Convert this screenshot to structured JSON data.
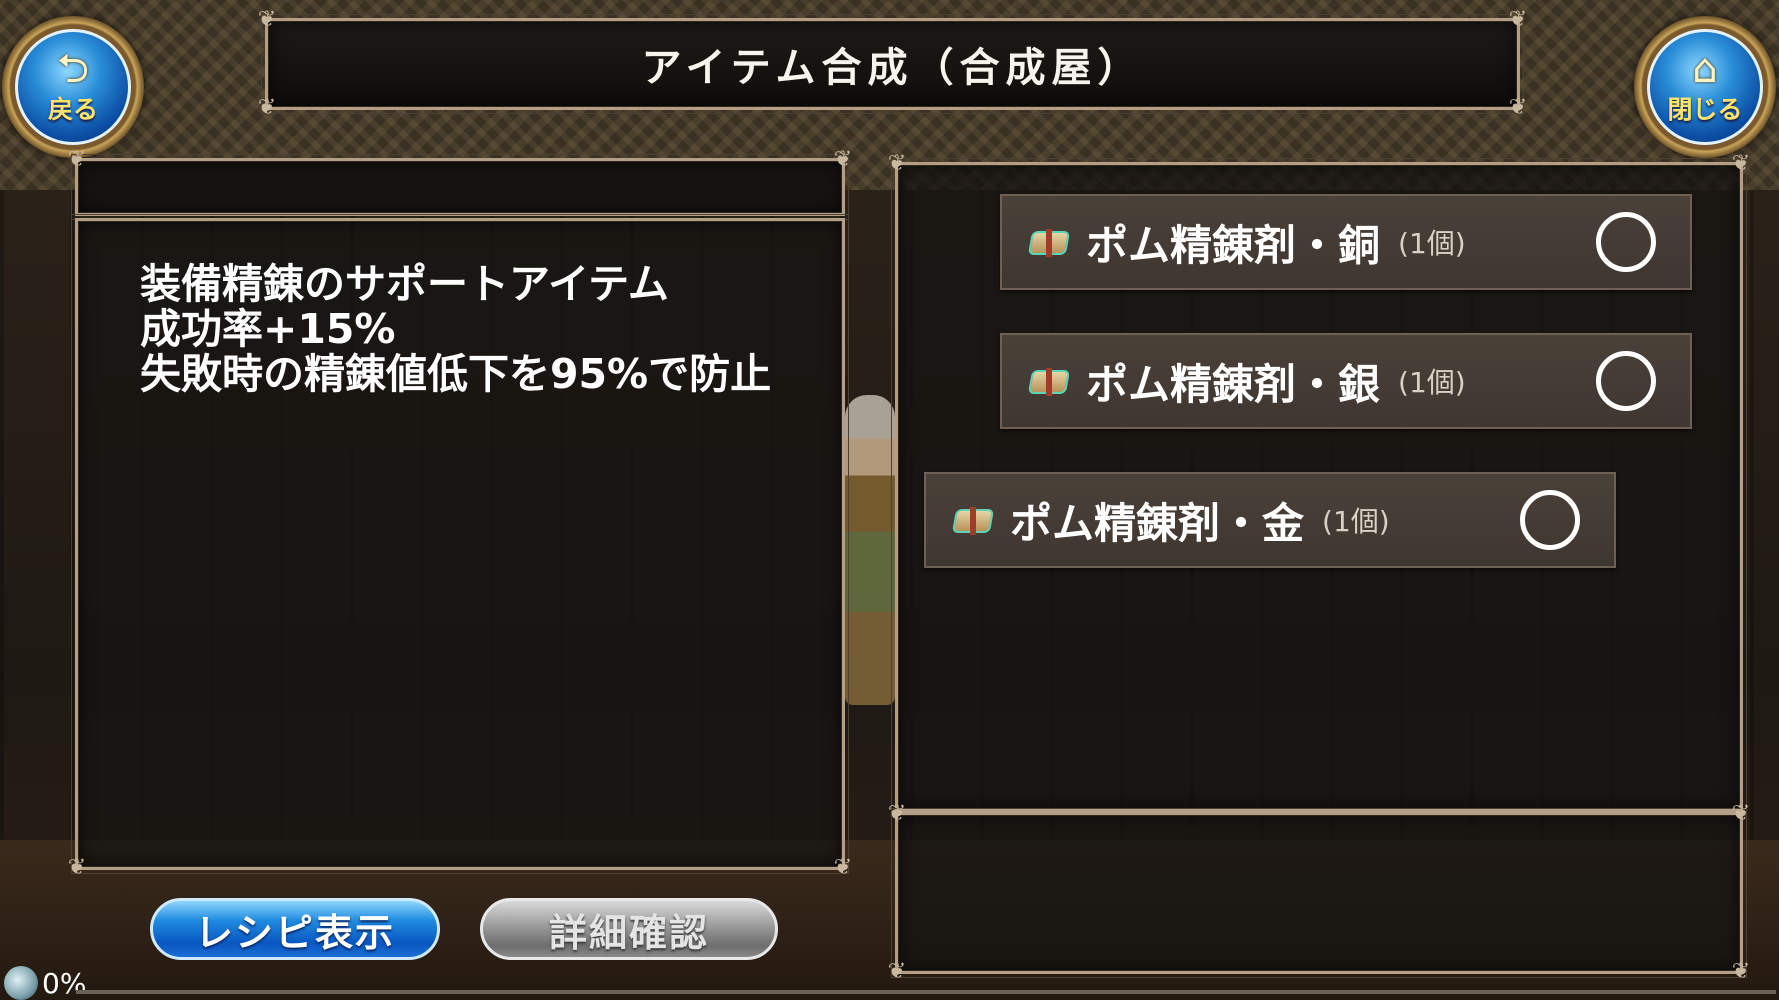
{
  "header": {
    "title": "アイテム合成（合成屋）",
    "back_label": "戻る",
    "close_label": "閉じる",
    "back_icon": "return-arrow-icon",
    "close_icon": "home-icon"
  },
  "description": {
    "lines": [
      "装備精錬のサポートアイテム",
      "成功率+15%",
      "失敗時の精錬値低下を95%で防止"
    ]
  },
  "recipes": [
    {
      "name": "ポム精錬剤・銅",
      "count": "(1個)",
      "icon": "package-icon",
      "selected": false
    },
    {
      "name": "ポム精錬剤・銀",
      "count": "(1個)",
      "icon": "package-icon",
      "selected": false
    },
    {
      "name": "ポム精錬剤・金",
      "count": "(1個)",
      "icon": "package-icon",
      "selected": false
    }
  ],
  "buttons": {
    "recipe_label": "レシピ表示",
    "detail_label": "詳細確認"
  },
  "loading": {
    "percent": "0%"
  },
  "colors": {
    "accent_blue": "#0a56c2",
    "gold": "#c9a45a",
    "frame": "#b49f86"
  }
}
